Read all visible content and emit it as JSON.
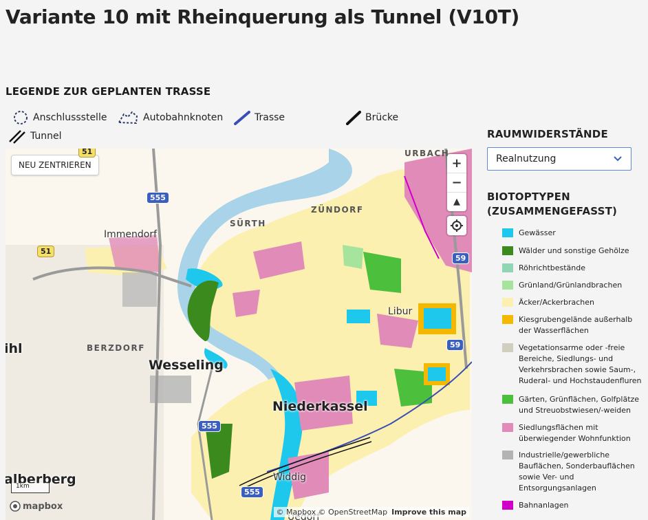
{
  "page_title": "Variante 10 mit Rheinquerung als Tunnel (V10T)",
  "legend": {
    "heading": "LEGENDE ZUR GEPLANTEN TRASSE",
    "items": [
      {
        "label": "Anschlussstelle",
        "icon": "dashed-circle-icon"
      },
      {
        "label": "Autobahnknoten",
        "icon": "dashed-shape-icon"
      },
      {
        "label": "Trasse",
        "icon": "blue-line-icon",
        "color": "#3a4db5"
      },
      {
        "label": "Brücke",
        "icon": "black-line-icon"
      },
      {
        "label": "Tunnel",
        "icon": "double-line-icon"
      }
    ]
  },
  "map": {
    "recenter_label": "NEU ZENTRIEREN",
    "zoom_in": "+",
    "zoom_out": "−",
    "compass": "▲",
    "places": {
      "urbach": "URBACH",
      "zuendorf": "ZÜNDORF",
      "suerth": "SÜRTH",
      "immendorf": "Immendorf",
      "berzdorf": "BERZDORF",
      "wesseling": "Wesseling",
      "libur": "Libur",
      "niederkassel": "Niederkassel",
      "widdig": "Widdig",
      "ihl": "ihl",
      "alberberg": "alberberg",
      "uedorf": "Uedorf"
    },
    "shields": {
      "r51a": "51",
      "r51b": "51",
      "a555a": "555",
      "a555b": "555",
      "a555c": "555",
      "a59a": "59",
      "a59b": "59"
    },
    "scale": "1km",
    "logo": "mapbox",
    "attribution": "© Mapbox © OpenStreetMap",
    "improve": "Improve this map"
  },
  "panel": {
    "raumwiderstaende_heading": "RAUMWIDERSTÄNDE",
    "select_value": "Realnutzung",
    "biotop_heading_1": "BIOTOPTYPEN",
    "biotop_heading_2": "(ZUSAMMENGEFASST)",
    "biotop_items": [
      {
        "label": "Gewässer",
        "color": "#1ec8ec"
      },
      {
        "label": "Wälder und sonstige Gehölze",
        "color": "#3a8a1e"
      },
      {
        "label": "Röhrichtbestände",
        "color": "#8ed6b4"
      },
      {
        "label": "Grünland/Grünlandbrachen",
        "color": "#a6e39c"
      },
      {
        "label": "Äcker/Ackerbrachen",
        "color": "#fcf0b0"
      },
      {
        "label": "Kiesgrubengelände außerhalb der Wasserflächen",
        "color": "#f5b800"
      },
      {
        "label": "Vegetationsarme oder -freie Bereiche, Siedlungs- und Verkehrsbrachen sowie Saum-, Ruderal- und Hochstaudenfluren",
        "color": "#d0cfbf"
      },
      {
        "label": "Gärten, Grünflächen, Golfplätze und Streuobstwiesen/-weiden",
        "color": "#4cbf3c"
      },
      {
        "label": "Siedlungsflächen mit überwiegender Wohnfunktion",
        "color": "#e08bb8"
      },
      {
        "label": "Industrielle/gewerbliche Bauflächen, Sonderbauflächen sowie Ver- und Entsorgungsanlagen",
        "color": "#b3b3b3"
      },
      {
        "label": "Bahnanlagen",
        "color": "#d000c8"
      }
    ]
  }
}
